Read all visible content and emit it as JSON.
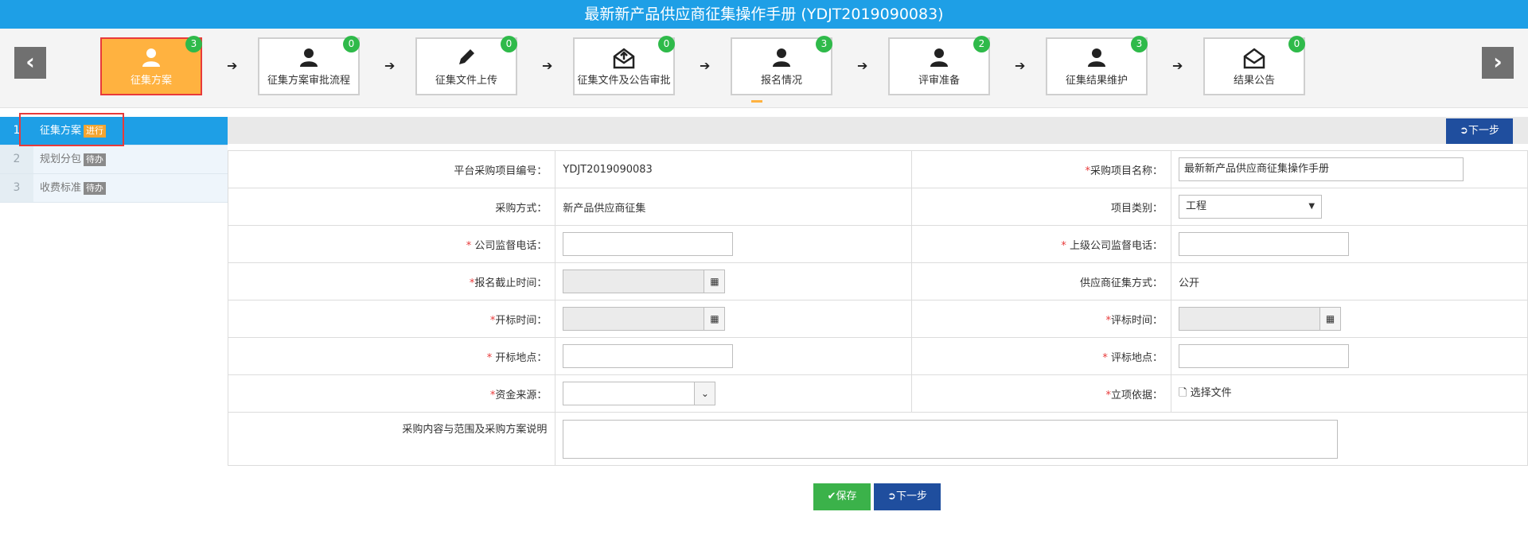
{
  "window": {
    "title": "最新新产品供应商征集操作手册 (YDJT2019090083)"
  },
  "colors": {
    "accent": "#1e9fe6",
    "active_step": "#ffb240",
    "badge": "#2fba4a",
    "primary_button": "#1f4e9e",
    "save_button": "#3bb24a",
    "required_mark": "#e83a3a"
  },
  "nav": {
    "prev_icon": "‹",
    "next_icon": "›"
  },
  "steps": [
    {
      "label": "征集方案",
      "count": "3",
      "icon": "user-icon"
    },
    {
      "label": "征集方案审批流程",
      "count": "0",
      "icon": "user-icon"
    },
    {
      "label": "征集文件上传",
      "count": "0",
      "icon": "pencil-icon"
    },
    {
      "label": "征集文件及公告审批",
      "count": "0",
      "icon": "envelope-upload-icon"
    },
    {
      "label": "报名情况",
      "count": "3",
      "icon": "user-icon"
    },
    {
      "label": "评审准备",
      "count": "2",
      "icon": "user-icon"
    },
    {
      "label": "征集结果维护",
      "count": "3",
      "icon": "user-icon"
    },
    {
      "label": "结果公告",
      "count": "0",
      "icon": "envelope-icon"
    }
  ],
  "sidebar": {
    "items": [
      {
        "num": "1",
        "label": "征集方案",
        "status": "进行"
      },
      {
        "num": "2",
        "label": "规划分包",
        "status": "待办"
      },
      {
        "num": "3",
        "label": "收费标准",
        "status": "待办"
      }
    ]
  },
  "toolbar": {
    "next_label": "下一步"
  },
  "form": {
    "project_no_label": "平台采购项目编号：",
    "project_no_value": "YDJT2019090083",
    "project_name_label": "采购项目名称：",
    "project_name_value": "最新新产品供应商征集操作手册",
    "method_label": "采购方式：",
    "method_value": "新产品供应商征集",
    "category_label": "项目类别：",
    "category_value": "工程",
    "company_phone_label": " 公司监督电话：",
    "company_phone_value": "",
    "parent_phone_label": " 上级公司监督电话：",
    "parent_phone_value": "",
    "deadline_label": "报名截止时间：",
    "deadline_value": "",
    "collect_method_label": "供应商征集方式：",
    "collect_method_value": "公开",
    "open_time_label": "开标时间：",
    "open_time_value": "",
    "review_time_label": "评标时间：",
    "review_time_value": "",
    "open_place_label": " 开标地点：",
    "open_place_value": "",
    "review_place_label": " 评标地点：",
    "review_place_value": "",
    "fund_source_label": "资金来源：",
    "fund_source_value": "",
    "basis_label": "立项依据：",
    "basis_file_label": "选择文件",
    "content_label": "采购内容与范围及采购方案说明",
    "required_mark": "*"
  },
  "footer": {
    "save_label": "保存",
    "next_label": "下一步"
  }
}
